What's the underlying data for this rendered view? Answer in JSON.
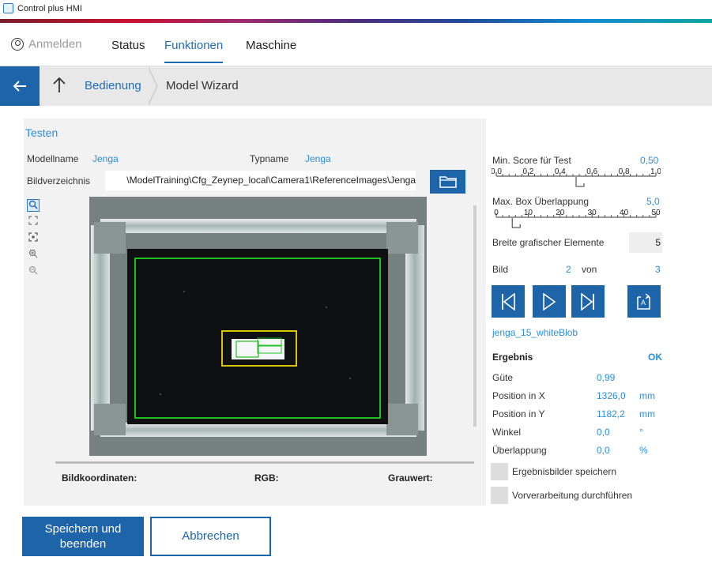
{
  "window": {
    "title": "Control plus HMI"
  },
  "nav": {
    "login": "Anmelden",
    "items": [
      "Status",
      "Funktionen",
      "Maschine"
    ],
    "active": "Funktionen"
  },
  "breadcrumb": {
    "parent": "Bedienung",
    "current": "Model Wizard"
  },
  "section_title": "Testen",
  "model": {
    "name_label": "Modellname",
    "name_value": "Jenga",
    "type_label": "Typname",
    "type_value": "Jenga",
    "dir_label": "Bildverzeichnis",
    "dir_value": "\\ModelTraining\\Cfg_Zeynep_local\\Camera1\\ReferenceImages\\Jenga"
  },
  "status_bar": {
    "coords": "Bildkoordinaten:",
    "rgb": "RGB:",
    "gray": "Grauwert:"
  },
  "settings": {
    "min_score_label": "Min. Score für Test",
    "min_score_value": "0,50",
    "min_score_fraction": 0.5,
    "min_score_ticks": [
      "0,0",
      "0,2",
      "0,4",
      "0,6",
      "0,8",
      "1,0"
    ],
    "max_box_label": "Max. Box Überlappung",
    "max_box_value": "5,0",
    "max_box_fraction": 0.1,
    "max_box_ticks": [
      "0",
      "10",
      "20",
      "30",
      "40",
      "50"
    ],
    "width_label": "Breite grafischer Elemente",
    "width_value": "5"
  },
  "image_nav": {
    "label": "Bild",
    "current": "2",
    "of": "von",
    "total": "3",
    "filename": "jenga_15_whiteBlob"
  },
  "result": {
    "title": "Ergebnis",
    "status": "OK",
    "rows": [
      {
        "label": "Güte",
        "value": "0,99",
        "unit": ""
      },
      {
        "label": "Position in X",
        "value": "1326,0",
        "unit": "mm"
      },
      {
        "label": "Position in Y",
        "value": "1182,2",
        "unit": "mm"
      },
      {
        "label": "Winkel",
        "value": "0,0",
        "unit": "°"
      },
      {
        "label": "Überlappung",
        "value": "0,0",
        "unit": "%"
      }
    ]
  },
  "options": {
    "save_images": "Ergebnisbilder speichern",
    "preprocess": "Vorverarbeitung durchführen"
  },
  "buttons": {
    "save": "Speichern und beenden",
    "cancel": "Abbrechen"
  },
  "colors": {
    "accent": "#1e64a8",
    "link": "#2b8fd6",
    "ok": "#2b8fd6"
  }
}
